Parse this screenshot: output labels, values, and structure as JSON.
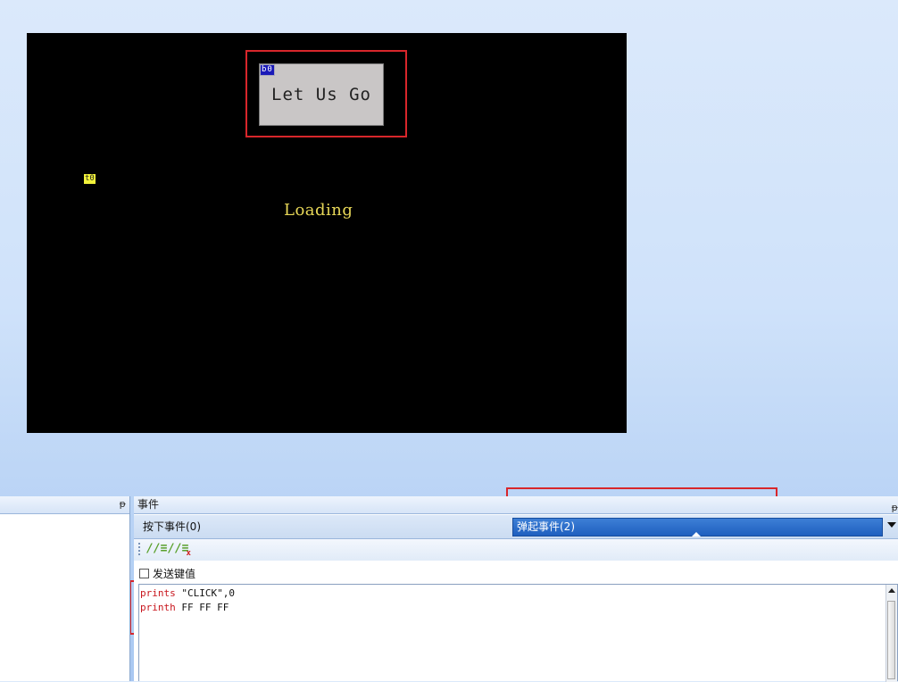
{
  "canvas": {
    "button_b0": {
      "tag": "b0",
      "label": "Let Us Go"
    },
    "text_t0": {
      "tag": "t0",
      "label": "Loading"
    }
  },
  "left_panel": {
    "pin_glyph": "ᵽ"
  },
  "events_panel": {
    "title": "事件",
    "pin_glyph": "ᵽ",
    "tabs": [
      {
        "label": "按下事件(0)",
        "selected": false
      },
      {
        "label": "弹起事件(2)",
        "selected": true
      }
    ],
    "toolbar": {
      "comment_glyph": "//≡",
      "uncomment_glyph": "//≡",
      "uncomment_mark": "x"
    },
    "send_key_checkbox": {
      "label": "发送键值",
      "checked": false
    },
    "code": {
      "line1": {
        "keyword": "prints",
        "argument": " \"CLICK\",0"
      },
      "line2": {
        "keyword": "printh",
        "argument": " FF FF FF"
      }
    }
  },
  "colors": {
    "annotation_red": "#d8262b",
    "selected_tab_blue": "#1f5fbf",
    "loading_text": "#e8d858",
    "keyword_red": "#c8161d"
  }
}
